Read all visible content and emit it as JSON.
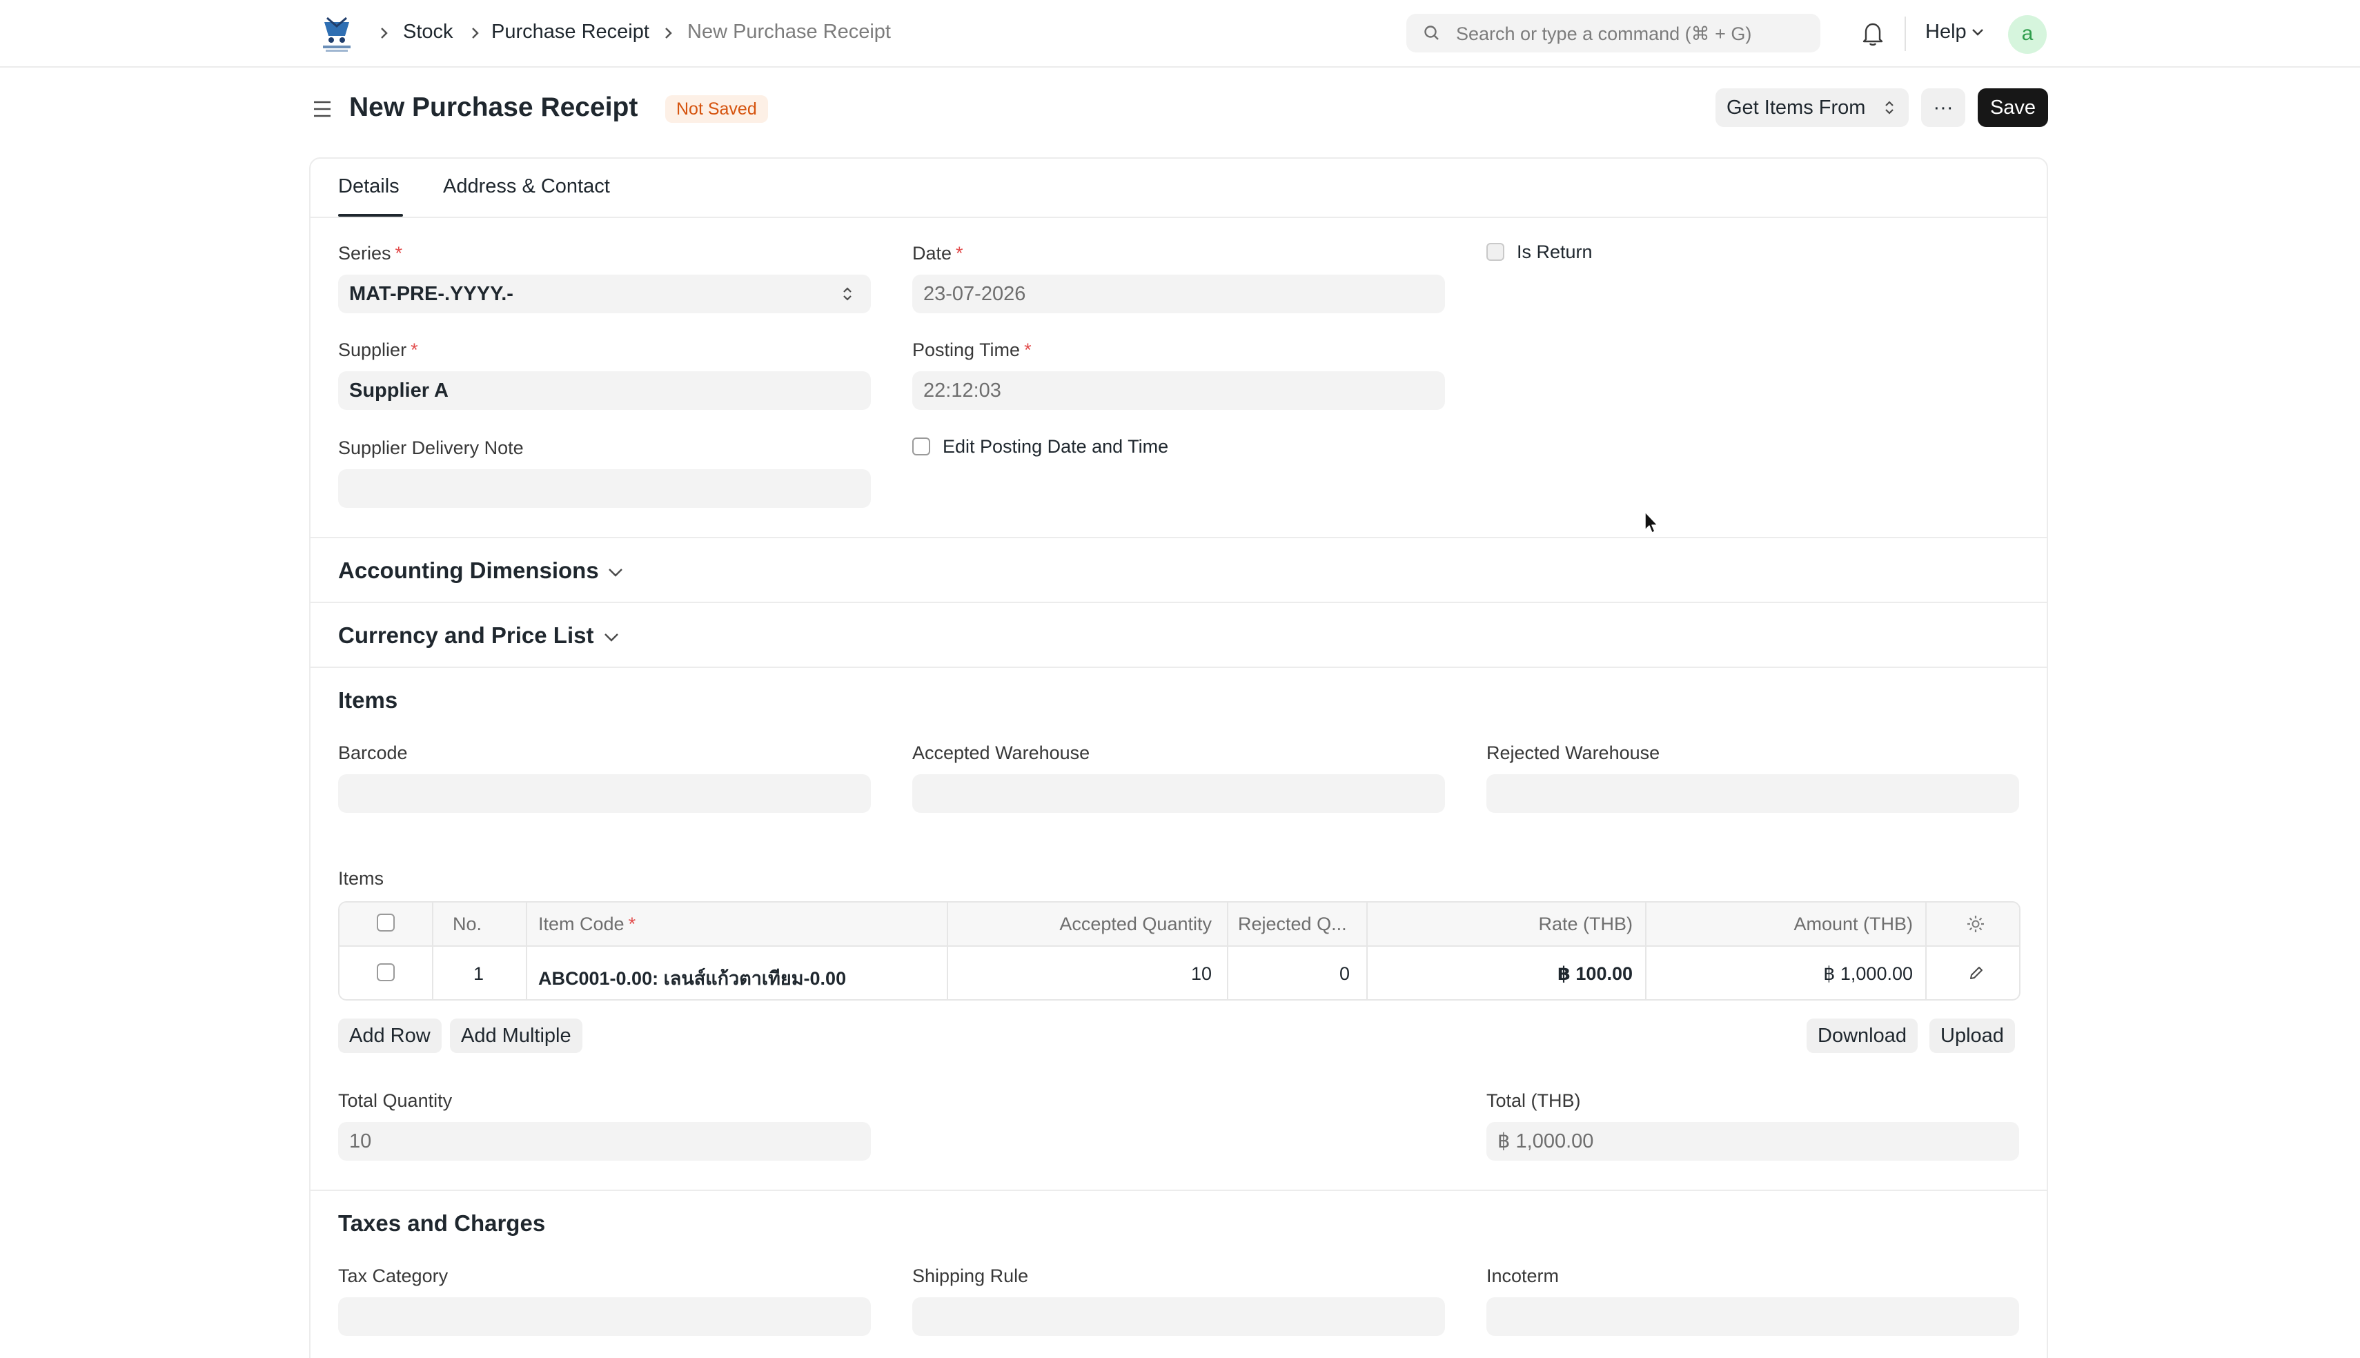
{
  "navbar": {
    "breadcrumbs": [
      "Stock",
      "Purchase Receipt",
      "New Purchase Receipt"
    ],
    "search_placeholder": "Search or type a command (⌘ + G)",
    "help_label": "Help",
    "avatar_initial": "a"
  },
  "page": {
    "title": "New Purchase Receipt",
    "status_badge": "Not Saved",
    "get_items_label": "Get Items From",
    "more_label": "···",
    "save_label": "Save"
  },
  "tabs": [
    {
      "label": "Details",
      "active": true
    },
    {
      "label": "Address & Contact",
      "active": false
    }
  ],
  "details": {
    "series_label": "Series",
    "series_value": "MAT-PRE-.YYYY.-",
    "date_label": "Date",
    "date_value": "23-07-2026",
    "is_return_label": "Is Return",
    "supplier_label": "Supplier",
    "supplier_value": "Supplier A",
    "posting_time_label": "Posting Time",
    "posting_time_value": "22:12:03",
    "supplier_delivery_note_label": "Supplier Delivery Note",
    "supplier_delivery_note_value": "",
    "edit_posting_label": "Edit Posting Date and Time",
    "required_mark": "*"
  },
  "sections": {
    "accounting_dimensions": "Accounting Dimensions",
    "currency_price_list": "Currency and Price List",
    "items": "Items",
    "taxes_and_charges": "Taxes and Charges"
  },
  "items_section": {
    "barcode_label": "Barcode",
    "accepted_warehouse_label": "Accepted Warehouse",
    "rejected_warehouse_label": "Rejected Warehouse",
    "table_label": "Items",
    "columns": [
      "No.",
      "Item Code",
      "Accepted Quantity",
      "Rejected Q...",
      "Rate (THB)",
      "Amount (THB)"
    ],
    "rows": [
      {
        "no": "1",
        "item_code": "ABC001-0.00: เลนส์แก้วตาเทียม-0.00",
        "accepted_qty": "10",
        "rejected_qty": "0",
        "rate": "฿ 100.00",
        "amount": "฿ 1,000.00"
      }
    ],
    "add_row_label": "Add Row",
    "add_multiple_label": "Add Multiple",
    "download_label": "Download",
    "upload_label": "Upload",
    "total_quantity_label": "Total Quantity",
    "total_quantity_value": "10",
    "total_label": "Total (THB)",
    "total_value": "฿ 1,000.00"
  },
  "taxes": {
    "tax_category_label": "Tax Category",
    "shipping_rule_label": "Shipping Rule",
    "incoterm_label": "Incoterm"
  },
  "colors": {
    "primary_dark": "#171717",
    "badge_bg": "#fdf0e6",
    "badge_text": "#d5530e",
    "required": "#e24c4c",
    "field_bg": "#f3f3f3",
    "avatar_bg": "#d6f5dd",
    "avatar_text": "#2f9d4c"
  }
}
